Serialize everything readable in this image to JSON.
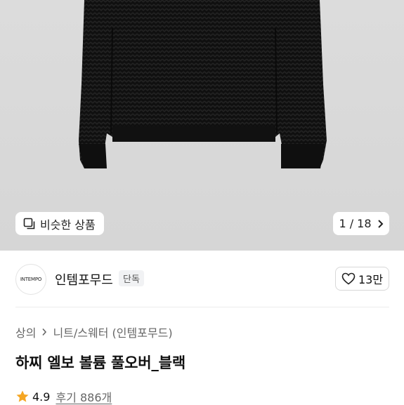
{
  "gallery": {
    "similar_label": "비슷한 상품",
    "similar_icon": "copy-icon",
    "page_indicator": "1 / 18",
    "next_icon": "chevron-right-icon"
  },
  "seller": {
    "logo_text": "INTEMPO",
    "brand_name": "인템포무드",
    "exclusive_badge": "단독",
    "like_icon": "heart-icon",
    "like_count": "13만"
  },
  "breadcrumb": {
    "level1": "상의",
    "separator_icon": "chevron-right-icon",
    "level2": "니트/스웨터 (인템포무드)"
  },
  "product": {
    "title": "하찌 엘보 볼륨 풀오버_블랙",
    "rating_icon": "star-icon",
    "rating": "4.9",
    "reviews": "후기 886개"
  },
  "colors": {
    "background": "#d9d9d9",
    "garment": "#151515",
    "star": "#f5a623"
  }
}
